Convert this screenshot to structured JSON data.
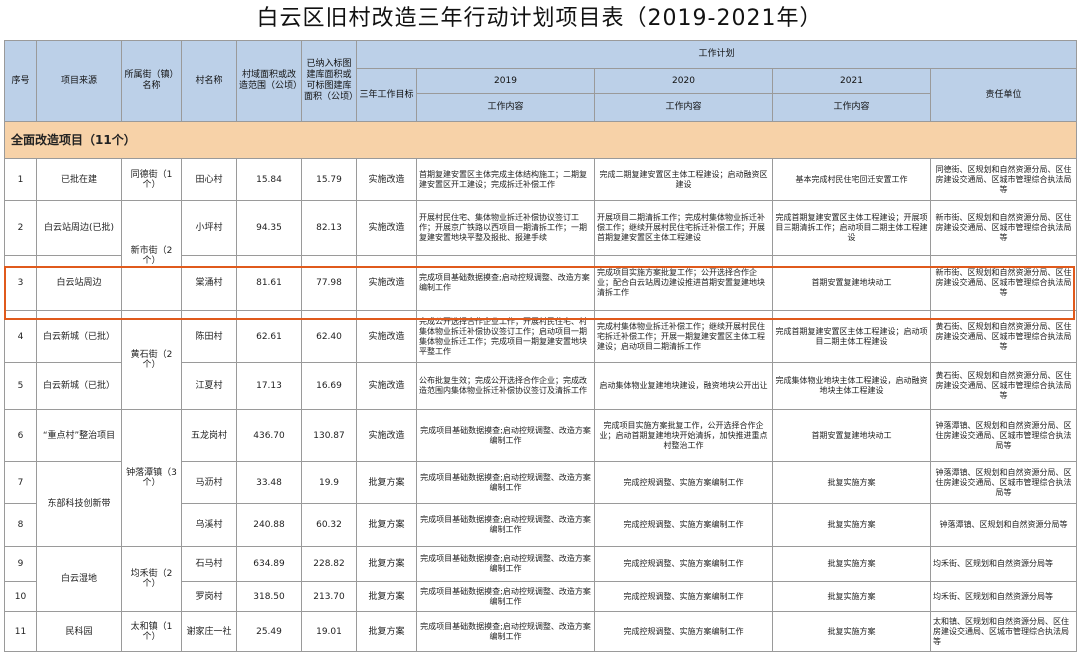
{
  "title": "白云区旧村改造三年行动计划项目表（2019-2021年）",
  "headers": {
    "seq": "序号",
    "source": "项目来源",
    "street": "所属街（镇）名称",
    "village": "村名称",
    "area": "村域面积或改造范围（公顷）",
    "base_area": "已纳入标图建库面积或可标图建库面积（公顷）",
    "three_year_goal": "三年工作目标",
    "plan": "工作计划",
    "y2019": "2019",
    "y2020": "2020",
    "y2021": "2021",
    "content": "工作内容",
    "owner": "责任单位"
  },
  "section": "全面改造项目（11个）",
  "rows": [
    {
      "seq": "1",
      "source": "已批在建",
      "street": "同德街（1个）",
      "village": "田心村",
      "area": "15.84",
      "base": "15.79",
      "goal": "实施改造",
      "w2019": "首期复建安置区主体完成主体结构施工；二期复建安置区开工建设；完成拆迁补偿工作",
      "w2020": "完成二期复建安置区主体工程建设；启动融资区建设",
      "w2021": "基本完成村民住宅回迁安置工作",
      "owner": "同德街、区规划和自然资源分局、区住房建设交通局、区城市管理综合执法局等"
    },
    {
      "seq": "2",
      "source": "白云站周边(已批)",
      "street": "新市街（2个）",
      "village": "小坪村",
      "area": "94.35",
      "base": "82.13",
      "goal": "实施改造",
      "w2019": "开展村民住宅、集体物业拆迁补偿协议签订工作；开展京广铁路以西项目一期清拆工作；一期复建安置地块平整及报批、报建手续",
      "w2020": "开展项目二期清拆工作；完成村集体物业拆迁补偿工作；继续开展村民住宅拆迁补偿工作；开展首期复建安置区主体工程建设",
      "w2021": "完成首期复建安置区主体工程建设；开展项目三期清拆工作；启动项目二期主体工程建设",
      "owner": "新市街、区规划和自然资源分局、区住房建设交通局、区城市管理综合执法局等"
    },
    {
      "seq": "3",
      "source": "白云站周边",
      "street": "",
      "village": "棠涌村",
      "area": "81.61",
      "base": "77.98",
      "goal": "实施改造",
      "w2019": "完成项目基础数据摸查;启动控规调整、改造方案编制工作",
      "w2020": "完成项目实施方案批复工作；公开选择合作企业；配合白云站周边建设推进首期安置复建地块清拆工作",
      "w2021": "首期安置复建地块动工",
      "owner": "新市街、区规划和自然资源分局、区住房建设交通局、区城市管理综合执法局等"
    },
    {
      "seq": "4",
      "source": "白云新城（已批）",
      "street": "黄石街（2个）",
      "village": "陈田村",
      "area": "62.61",
      "base": "62.40",
      "goal": "实施改造",
      "w2019": "完成公开选择合作企业工作；开展村民住宅、村集体物业拆迁补偿协议签订工作；启动项目一期集体物业拆迁工作；完成项目一期复建安置地块平整工作",
      "w2020": "完成村集体物业拆迁补偿工作；继续开展村民住宅拆迁补偿工作；开展一期复建安置区主体工程建设；启动项目二期清拆工作",
      "w2021": "完成首期复建安置区主体工程建设；启动项目二期主体工程建设",
      "owner": "黄石街、区规划和自然资源分局、区住房建设交通局、区城市管理综合执法局等"
    },
    {
      "seq": "5",
      "source": "白云新城（已批）",
      "street": "",
      "village": "江夏村",
      "area": "17.13",
      "base": "16.69",
      "goal": "实施改造",
      "w2019": "公布批复生效；完成公开选择合作企业；完成改造范围内集体物业拆迁补偿协议签订及清拆工作",
      "w2020": "启动集体物业复建地块建设，融资地块公开出让",
      "w2021": "完成集体物业地块主体工程建设，启动融资地块主体工程建设",
      "owner": "黄石街、区规划和自然资源分局、区住房建设交通局、区城市管理综合执法局等"
    },
    {
      "seq": "6",
      "source": "“重点村”整治项目",
      "street": "钟落潭镇（3个）",
      "village": "五龙岗村",
      "area": "436.70",
      "base": "130.87",
      "goal": "实施改造",
      "w2019": "完成项目基础数据摸查;启动控规调整、改造方案编制工作",
      "w2020": "完成项目实施方案批复工作，公开选择合作企业；启动首期复建地块开始清拆，加快推进重点村整治工作",
      "w2021": "首期安置复建地块动工",
      "owner": "钟落潭镇、区规划和自然资源分局、区住房建设交通局、区城市管理综合执法局等"
    },
    {
      "seq": "7",
      "source": "东部科技创新带",
      "street": "",
      "village": "马沥村",
      "area": "33.48",
      "base": "19.9",
      "goal": "批复方案",
      "w2019": "完成项目基础数据摸查;启动控规调整、改造方案编制工作",
      "w2020": "完成控规调整、实施方案编制工作",
      "w2021": "批复实施方案",
      "owner": "钟落潭镇、区规划和自然资源分局、区住房建设交通局、区城市管理综合执法局等"
    },
    {
      "seq": "8",
      "source": "",
      "street": "",
      "village": "乌溪村",
      "area": "240.88",
      "base": "60.32",
      "goal": "批复方案",
      "w2019": "完成项目基础数据摸查;启动控规调整、改造方案编制工作",
      "w2020": "完成控规调整、实施方案编制工作",
      "w2021": "批复实施方案",
      "owner": "钟落潭镇、区规划和自然资源分局等"
    },
    {
      "seq": "9",
      "source": "白云湿地",
      "street": "均禾街（2个）",
      "village": "石马村",
      "area": "634.89",
      "base": "228.82",
      "goal": "批复方案",
      "w2019": "完成项目基础数据摸查;启动控规调整、改造方案编制工作",
      "w2020": "完成控规调整、实施方案编制工作",
      "w2021": "批复实施方案",
      "owner": "均禾街、区规划和自然资源分局等"
    },
    {
      "seq": "10",
      "source": "",
      "street": "",
      "village": "罗岗村",
      "area": "318.50",
      "base": "213.70",
      "goal": "批复方案",
      "w2019": "完成项目基础数据摸查;启动控规调整、改造方案编制工作",
      "w2020": "完成控规调整、实施方案编制工作",
      "w2021": "批复实施方案",
      "owner": "均禾街、区规划和自然资源分局等"
    },
    {
      "seq": "11",
      "source": "民科园",
      "street": "太和镇（1个）",
      "village": "谢家庄一社",
      "area": "25.49",
      "base": "19.01",
      "goal": "批复方案",
      "w2019": "完成项目基础数据摸查;启动控规调整、改造方案编制工作",
      "w2020": "完成控规调整、实施方案编制工作",
      "w2021": "批复实施方案",
      "owner": "太和镇、区规划和自然资源分局、区住房建设交通局、区城市管理综合执法局等"
    }
  ],
  "highlight_color": "#e05a1c",
  "header_bg": "#bcd0e8",
  "section_bg": "#f7d2a8"
}
